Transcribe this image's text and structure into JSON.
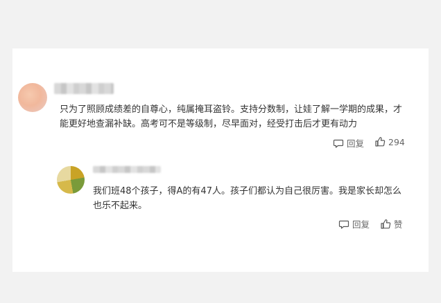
{
  "comments": [
    {
      "text_line1": "只为了照顾成绩差的自尊心，纯属掩耳盗铃。支持分数制，让娃了解一学期的成果，才",
      "text_line2": "能更好地查漏补缺。高考可不是等级制，尽早面对，经受打击后才更有动力",
      "reply_label": "回复",
      "like_label": "294"
    },
    {
      "text_line1": "我们班48个孩子，得A的有47人。孩子们都认为自己很厉害。我是家长却怎么",
      "text_line2": "也乐不起来。",
      "reply_label": "回复",
      "like_label": "赞"
    }
  ],
  "icons": {
    "reply": "comment-bubble-icon",
    "like": "thumbs-up-icon"
  },
  "colors": {
    "background": "#f2f2f2",
    "card": "#ffffff",
    "text": "#333333",
    "action": "#666666"
  }
}
